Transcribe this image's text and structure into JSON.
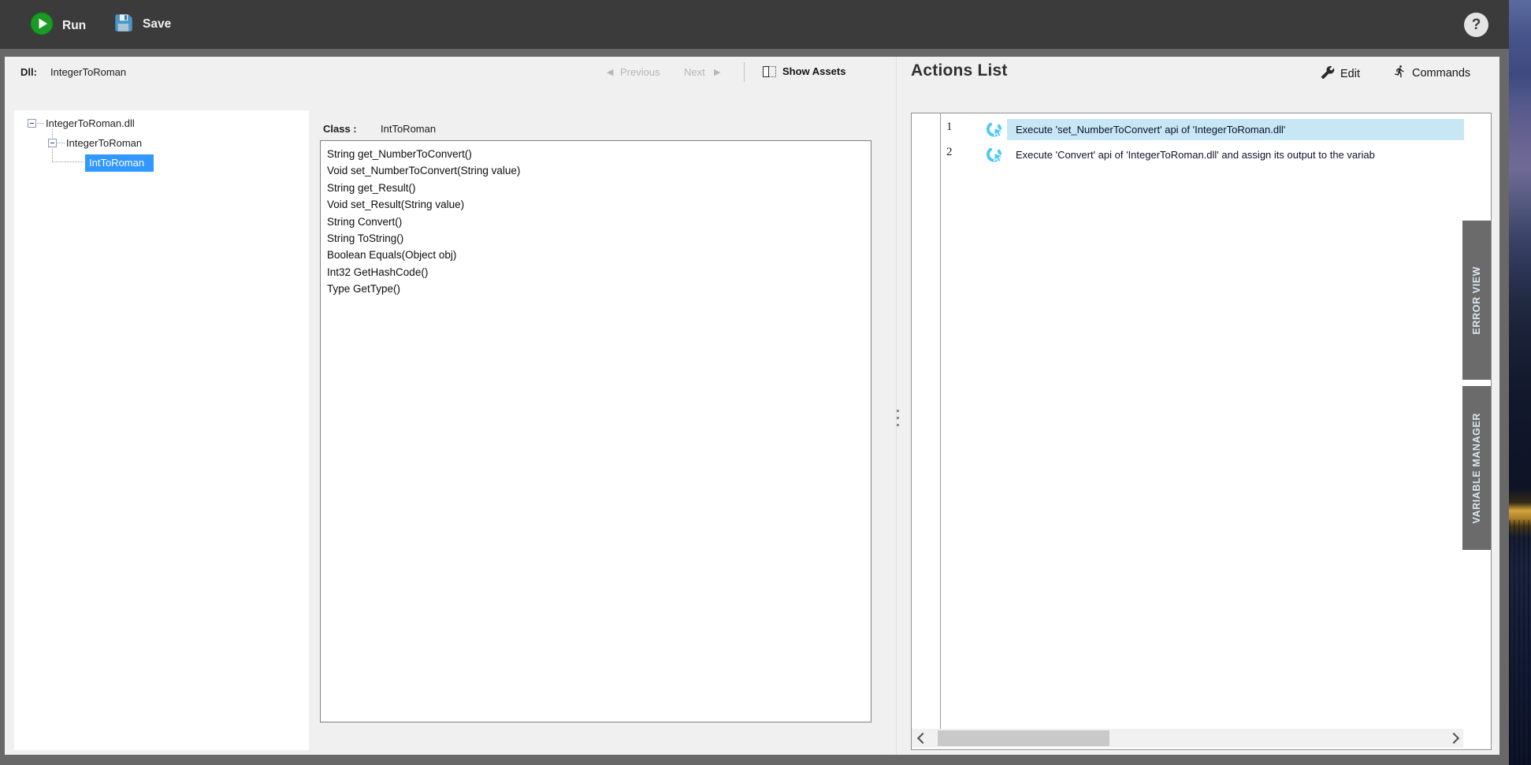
{
  "toolbar": {
    "run_label": "Run",
    "save_label": "Save",
    "help_label": "?"
  },
  "dll_panel": {
    "dll_label": "Dll:",
    "dll_value": "IntegerToRoman",
    "previous_label": "Previous",
    "next_label": "Next",
    "prev_arrow": "◀",
    "next_arrow": "▶",
    "show_assets_label": "Show Assets",
    "tree": {
      "items": [
        {
          "label": "IntegerToRoman.dll",
          "selected": false
        },
        {
          "label": "IntegerToRoman",
          "selected": false
        },
        {
          "label": "IntToRoman",
          "selected": true
        }
      ]
    },
    "class_label": "Class :",
    "class_value": "IntToRoman",
    "methods": [
      "String get_NumberToConvert()",
      "Void set_NumberToConvert(String value)",
      "String get_Result()",
      "Void set_Result(String value)",
      "String Convert()",
      "String ToString()",
      "Boolean Equals(Object obj)",
      "Int32 GetHashCode()",
      "Type GetType()"
    ]
  },
  "actions_panel": {
    "title": "Actions List",
    "edit_label": "Edit",
    "commands_label": "Commands",
    "actions": [
      {
        "num": "1",
        "text": "Execute 'set_NumberToConvert' api of 'IntegerToRoman.dll'",
        "selected": true
      },
      {
        "num": "2",
        "text": "Execute 'Convert' api of 'IntegerToRoman.dll' and assign its output to the variab",
        "selected": false
      }
    ]
  },
  "side_tabs": [
    {
      "label": "ERROR VIEW"
    },
    {
      "label": "VARIABLE MANAGER"
    }
  ],
  "colors": {
    "accent_blue": "#3298ff",
    "action_highlight": "#c7e7f4",
    "action_icon_cyan": "#49c9f5",
    "run_green": "#28a32c",
    "save_blue": "#4a96c8",
    "tab_gray": "#6b6b6b"
  }
}
